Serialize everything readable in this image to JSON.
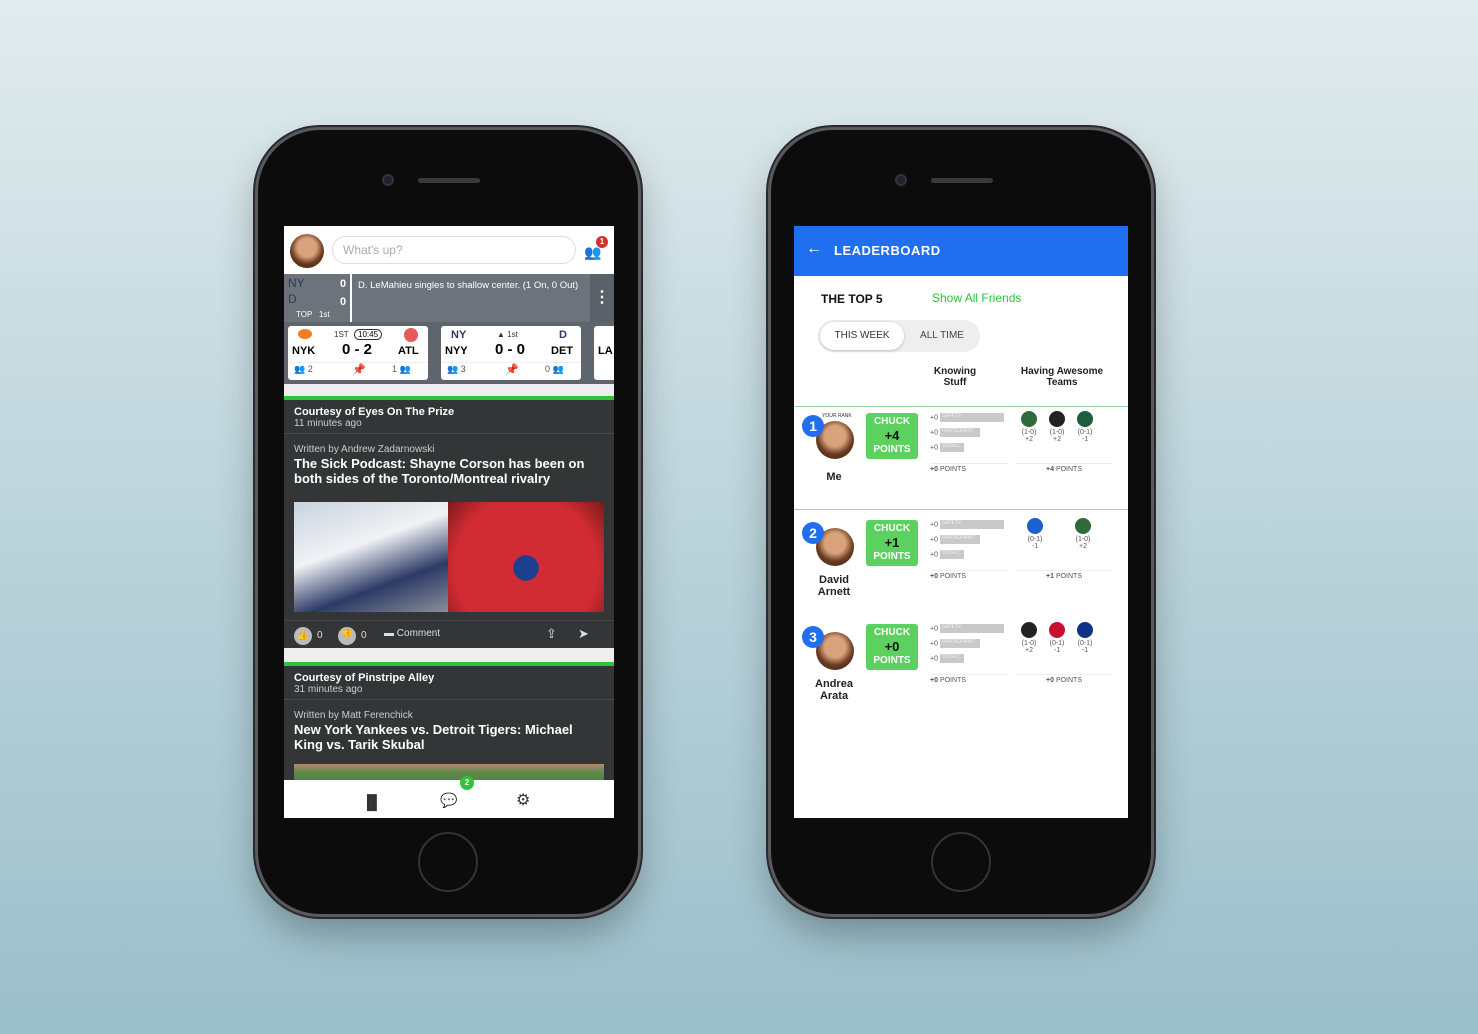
{
  "feed": {
    "search_placeholder": "What's up?",
    "notification_count": "1",
    "live": {
      "away_score": "0",
      "home_score": "0",
      "inning_half": "TOP",
      "inning": "1st",
      "play": "D. LeMahieu singles to shallow center. (1 On, 0 Out)"
    },
    "games": [
      {
        "away": "NYK",
        "home": "ATL",
        "period": "1ST",
        "clock": "10:45",
        "score": "0 - 2",
        "away_fans": "2",
        "home_fans": "1"
      },
      {
        "away": "NYY",
        "home": "DET",
        "period": "▲ 1st",
        "clock": "",
        "score": "0 - 0",
        "away_fans": "3",
        "home_fans": "0"
      },
      {
        "away": "LA"
      }
    ],
    "articles": [
      {
        "source": "Courtesy of Eyes On The Prize",
        "ago": "11 minutes ago",
        "author": "Written by Andrew Zadarnowski",
        "title": "The Sick Podcast: Shayne Corson has been on both sides of the Toronto/Montreal rivalry",
        "likes": "0",
        "dislikes": "0",
        "comment_label": "Comment"
      },
      {
        "source": "Courtesy of Pinstripe Alley",
        "ago": "31 minutes ago",
        "author": "Written by Matt Ferenchick",
        "title": "New York Yankees vs. Detroit Tigers: Michael King vs. Tarik Skubal"
      }
    ],
    "chat_badge": "2"
  },
  "leaderboard": {
    "title": "LEADERBOARD",
    "top_label": "THE TOP 5",
    "show_all": "Show All Friends",
    "tabs": [
      "THIS WEEK",
      "ALL TIME"
    ],
    "col1": "Knowing Stuff",
    "col2": "Having Awesome Teams",
    "your_rank": "YOUR RANK",
    "chuck": "CHUCK",
    "points_label": "POINTS",
    "categories": [
      "SAFETY",
      "PARTICIPANT",
      "SSBALL"
    ],
    "rows": [
      {
        "rank": "1",
        "name": "Me",
        "chuck": "+4",
        "cats": [
          "+0",
          "+0",
          "+0"
        ],
        "know_total": "+0",
        "teams": [
          {
            "rec": "(1-0)",
            "pts": "+2",
            "color": "#2f6b3a"
          },
          {
            "rec": "(1-0)",
            "pts": "+2",
            "color": "#222222"
          },
          {
            "rec": "(0-1)",
            "pts": "-1",
            "color": "#1e5e3a"
          }
        ],
        "team_total": "+4"
      },
      {
        "rank": "2",
        "name": "David Arnett",
        "chuck": "+1",
        "cats": [
          "+0",
          "+0",
          "+0"
        ],
        "know_total": "+0",
        "teams": [
          {
            "rec": "(0-1)",
            "pts": "-1",
            "color": "#1c5fd0"
          },
          {
            "rec": "(1-0)",
            "pts": "+2",
            "color": "#2f6b3a"
          }
        ],
        "team_total": "+1"
      },
      {
        "rank": "3",
        "name": "Andrea Arata",
        "chuck": "+0",
        "cats": [
          "+0",
          "+0",
          "+0"
        ],
        "know_total": "+0",
        "teams": [
          {
            "rec": "(1-0)",
            "pts": "+2",
            "color": "#222222"
          },
          {
            "rec": "(0-1)",
            "pts": "-1",
            "color": "#c8102e"
          },
          {
            "rec": "(0-1)",
            "pts": "-1",
            "color": "#0e3386"
          }
        ],
        "team_total": "+0"
      }
    ],
    "accent": "#1f6ff0",
    "chuck_color": "#5dd15f",
    "link_color": "#2bc43a"
  }
}
